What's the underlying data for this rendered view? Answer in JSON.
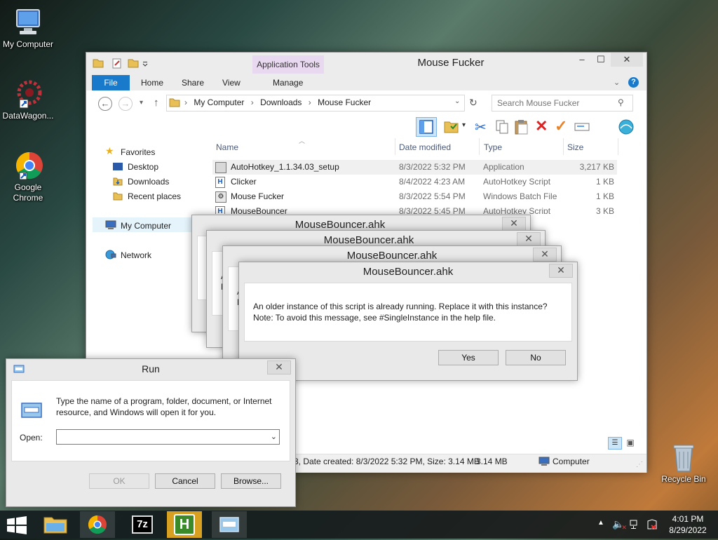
{
  "desktop": {
    "icons": [
      {
        "label": "My Computer"
      },
      {
        "label": "DataWagon..."
      },
      {
        "label": "Google Chrome"
      },
      {
        "label": "Recycle Bin"
      }
    ]
  },
  "explorer": {
    "title": "Mouse Fucker",
    "context_tab_group": "Application Tools",
    "tabs": {
      "file": "File",
      "home": "Home",
      "share": "Share",
      "view": "View",
      "manage": "Manage"
    },
    "window_controls": {
      "minimize": "–",
      "maximize": "☐",
      "close": "✕"
    },
    "breadcrumb": [
      "My Computer",
      "Downloads",
      "Mouse Fucker"
    ],
    "search_placeholder": "Search Mouse Fucker",
    "nav": {
      "favorites": "Favorites",
      "desktop": "Desktop",
      "downloads": "Downloads",
      "recent": "Recent places",
      "computer": "My Computer",
      "network": "Network"
    },
    "columns": {
      "name": "Name",
      "date": "Date modified",
      "type": "Type",
      "size": "Size"
    },
    "files": [
      {
        "name": "AutoHotkey_1.1.34.03_setup",
        "date": "8/3/2022 5:32 PM",
        "type": "Application",
        "size": "3,217 KB"
      },
      {
        "name": "Clicker",
        "date": "8/4/2022 4:23 AM",
        "type": "AutoHotkey Script",
        "size": "1 KB"
      },
      {
        "name": "Mouse Fucker",
        "date": "8/3/2022 5:54 PM",
        "type": "Windows Batch File",
        "size": "1 KB"
      },
      {
        "name": "MouseBouncer",
        "date": "8/3/2022 5:45 PM",
        "type": "AutoHotkey Script",
        "size": "3 KB"
      }
    ],
    "status": {
      "details": "3, Date created: 8/3/2022 5:32 PM, Size: 3.14 MB",
      "size": "3.14 MB",
      "location": "Computer"
    }
  },
  "ahk_dialogs": {
    "title": "MouseBouncer.ahk",
    "message_line1": "An older instance of this script is already running.  Replace it with this instance?",
    "message_line2": "Note: To avoid this message, see #SingleInstance in the help file.",
    "yes": "Yes",
    "no": "No",
    "close": "✕",
    "partial_glyph_a": "A",
    "partial_glyph_n": "N"
  },
  "run": {
    "title": "Run",
    "desc_line1": "Type the name of a program, folder, document, or Internet",
    "desc_line2": "resource, and Windows will open it for you.",
    "open_label": "Open:",
    "open_value": "",
    "ok": "OK",
    "cancel": "Cancel",
    "browse": "Browse...",
    "close": "✕"
  },
  "taskbar": {
    "time": "4:01 PM",
    "date": "8/29/2022",
    "apps": [
      "File Explorer",
      "Google Chrome",
      "7-Zip",
      "AutoHotkey",
      "Run"
    ],
    "sevenzip_label": "7z",
    "ahk_label": "H"
  },
  "colors": {
    "accent": "#1979ca",
    "context_tab": "#e8d8f0",
    "selected_row": "#e5f3fb"
  }
}
